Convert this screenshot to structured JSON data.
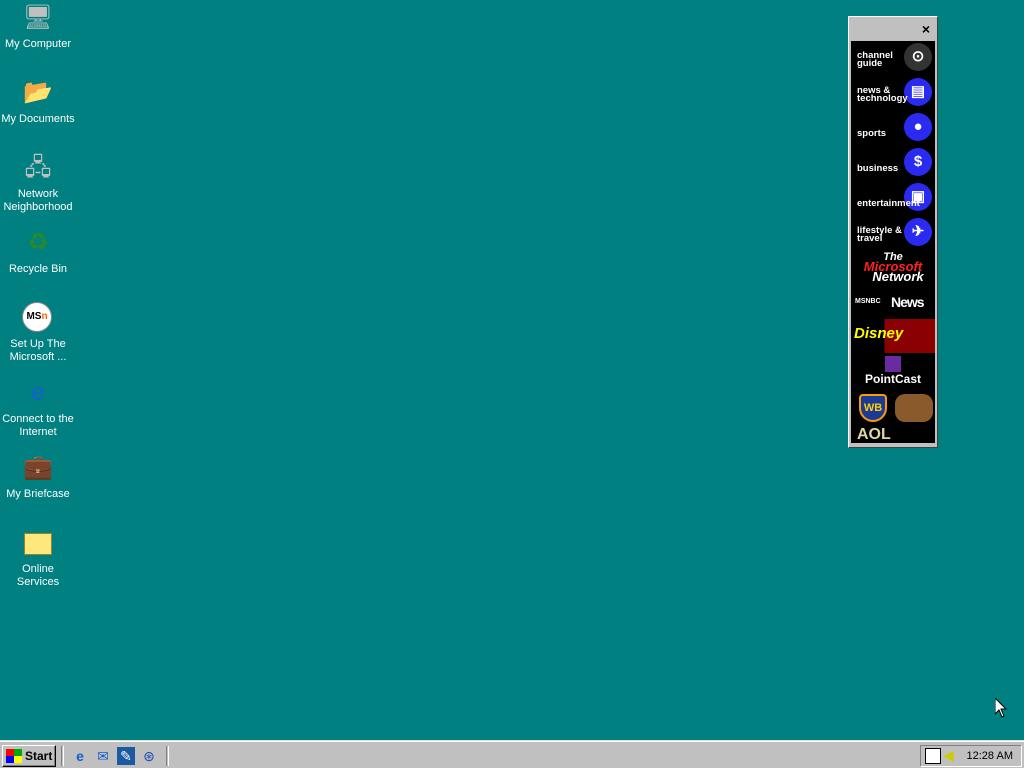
{
  "desktop": {
    "icons": [
      {
        "label": "My Computer",
        "icon": "computer-icon"
      },
      {
        "label": "My Documents",
        "icon": "folder-documents-icon"
      },
      {
        "label": "Network Neighborhood",
        "icon": "network-icon"
      },
      {
        "label": "Recycle Bin",
        "icon": "recycle-bin-icon"
      },
      {
        "label": "Set Up The Microsoft ...",
        "icon": "msn-icon"
      },
      {
        "label": "Connect to the Internet",
        "icon": "ie-connect-icon"
      },
      {
        "label": "My Briefcase",
        "icon": "briefcase-icon"
      },
      {
        "label": "Online Services",
        "icon": "folder-icon"
      }
    ]
  },
  "channel_bar": {
    "close": "×",
    "channels": [
      {
        "label": "channel guide",
        "icon": "satellite-dish-icon"
      },
      {
        "label": "news & technology",
        "icon": "newspaper-icon"
      },
      {
        "label": "sports",
        "icon": "soccer-ball-icon"
      },
      {
        "label": "business",
        "icon": "dollar-icon"
      },
      {
        "label": "entertainment",
        "icon": "tv-icon"
      },
      {
        "label": "lifestyle & travel",
        "icon": "airplane-icon"
      }
    ],
    "logos": {
      "msn_line1": "The",
      "msn_line2": "Microsoft",
      "msn_line3": "Network",
      "msnbc": "MSNBC",
      "msnbc_news": "News",
      "disney": "Disney",
      "pointcast": "PointCast",
      "wb": "WB",
      "aol": "AOL"
    }
  },
  "taskbar": {
    "start": "Start",
    "quicklaunch": [
      "ie-icon",
      "outlook-express-icon",
      "show-desktop-icon",
      "channels-icon"
    ],
    "clock": "12:28 AM"
  },
  "colors": {
    "desktop": "#008080",
    "taskbar": "#c0c0c0",
    "channel_accent": "#2a2af0"
  }
}
